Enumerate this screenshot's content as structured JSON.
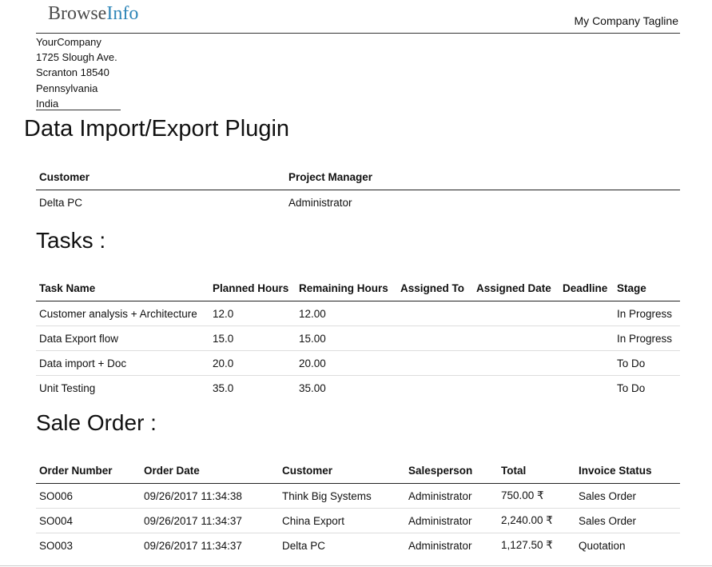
{
  "header": {
    "logo_text_main": "Browse",
    "logo_text_accent": "Info",
    "tagline": "My Company Tagline"
  },
  "company_address": {
    "name": "YourCompany",
    "street": "1725 Slough Ave.",
    "city_zip": "Scranton 18540",
    "state": "Pennsylvania",
    "country": "India"
  },
  "project": {
    "title": "Data Import/Export Plugin",
    "info_headers": [
      "Customer",
      "Project Manager"
    ],
    "customer": "Delta PC",
    "project_manager": "Administrator"
  },
  "tasks": {
    "section_title": "Tasks :",
    "columns": [
      "Task Name",
      "Planned Hours",
      "Remaining Hours",
      "Assigned To",
      "Assigned Date",
      "Deadline",
      "Stage"
    ],
    "rows": [
      {
        "name": "Customer analysis + Architecture",
        "planned": "12.0",
        "remaining": "12.00",
        "assigned_to": "",
        "assigned_date": "",
        "deadline": "",
        "stage": "In Progress"
      },
      {
        "name": "Data Export flow",
        "planned": "15.0",
        "remaining": "15.00",
        "assigned_to": "",
        "assigned_date": "",
        "deadline": "",
        "stage": "In Progress"
      },
      {
        "name": "Data import + Doc",
        "planned": "20.0",
        "remaining": "20.00",
        "assigned_to": "",
        "assigned_date": "",
        "deadline": "",
        "stage": "To Do"
      },
      {
        "name": "Unit Testing",
        "planned": "35.0",
        "remaining": "35.00",
        "assigned_to": "",
        "assigned_date": "",
        "deadline": "",
        "stage": "To Do"
      }
    ]
  },
  "sale_orders": {
    "section_title": "Sale Order :",
    "columns": [
      "Order Number",
      "Order Date",
      "Customer",
      "Salesperson",
      "Total",
      "Invoice Status"
    ],
    "rows": [
      {
        "number": "SO006",
        "date": "09/26/2017 11:34:38",
        "customer": "Think Big Systems",
        "salesperson": "Administrator",
        "total": "750.00 ₹",
        "status": "Sales Order"
      },
      {
        "number": "SO004",
        "date": "09/26/2017 11:34:37",
        "customer": "China Export",
        "salesperson": "Administrator",
        "total": "2,240.00 ₹",
        "status": "Sales Order"
      },
      {
        "number": "SO003",
        "date": "09/26/2017 11:34:37",
        "customer": "Delta PC",
        "salesperson": "Administrator",
        "total": "1,127.50 ₹",
        "status": "Quotation"
      }
    ]
  }
}
